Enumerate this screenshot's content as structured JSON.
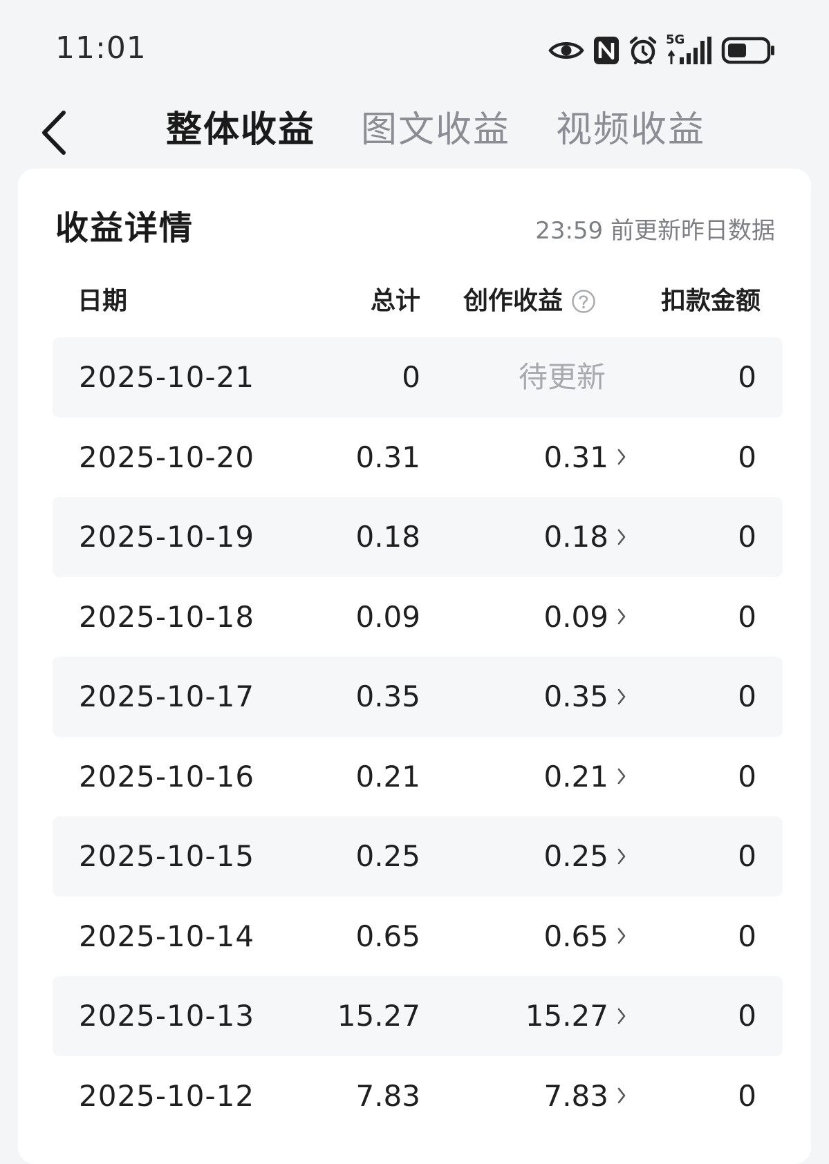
{
  "status_bar": {
    "time": "11:01",
    "network_label": "5G",
    "icons": [
      "eye-icon",
      "nfc-icon",
      "alarm-icon",
      "signal-icon",
      "battery-icon"
    ]
  },
  "header": {
    "tabs": [
      {
        "label": "整体收益",
        "active": true
      },
      {
        "label": "图文收益",
        "active": false
      },
      {
        "label": "视频收益",
        "active": false
      }
    ]
  },
  "card": {
    "title": "收益详情",
    "note": "23:59 前更新昨日数据"
  },
  "table": {
    "columns": {
      "date": "日期",
      "total": "总计",
      "creation": "创作收益",
      "deduction": "扣款金额"
    },
    "rows": [
      {
        "date": "2025-10-21",
        "total": "0",
        "creation": "待更新",
        "deduction": "0"
      },
      {
        "date": "2025-10-20",
        "total": "0.31",
        "creation": "0.31",
        "deduction": "0"
      },
      {
        "date": "2025-10-19",
        "total": "0.18",
        "creation": "0.18",
        "deduction": "0"
      },
      {
        "date": "2025-10-18",
        "total": "0.09",
        "creation": "0.09",
        "deduction": "0"
      },
      {
        "date": "2025-10-17",
        "total": "0.35",
        "creation": "0.35",
        "deduction": "0"
      },
      {
        "date": "2025-10-16",
        "total": "0.21",
        "creation": "0.21",
        "deduction": "0"
      },
      {
        "date": "2025-10-15",
        "total": "0.25",
        "creation": "0.25",
        "deduction": "0"
      },
      {
        "date": "2025-10-14",
        "total": "0.65",
        "creation": "0.65",
        "deduction": "0"
      },
      {
        "date": "2025-10-13",
        "total": "15.27",
        "creation": "15.27",
        "deduction": "0"
      },
      {
        "date": "2025-10-12",
        "total": "7.83",
        "creation": "7.83",
        "deduction": "0"
      }
    ]
  }
}
